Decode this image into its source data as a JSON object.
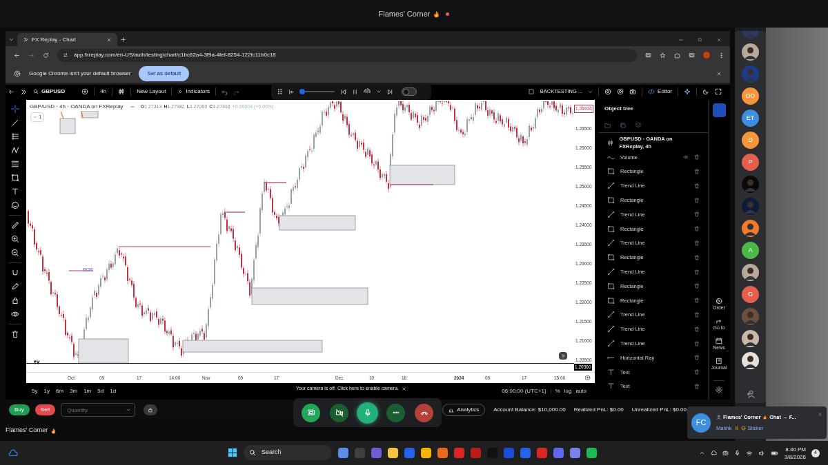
{
  "call": {
    "title": "Flames' Corner",
    "footer_label": "Flames' Corner",
    "camera_notice": "Your camera is off. Click here to enable camera.",
    "controls": [
      {
        "kind": "share",
        "selected": false
      },
      {
        "kind": "camera",
        "selected": false
      },
      {
        "kind": "mic",
        "selected": true
      },
      {
        "kind": "more",
        "selected": false
      },
      {
        "kind": "hangup",
        "selected": false
      }
    ]
  },
  "browser": {
    "tab": "FX Replay - Chart",
    "url": "app.fxreplay.com/en-US/auth/testing/chart/c1bc62a4-3f9a-4fef-8254-122fc11b0c18",
    "infobar": {
      "text": "Google Chrome isn't your default browser",
      "button": "Set as default"
    }
  },
  "toolbar": {
    "symbol": "GBPUSD",
    "interval": "4h",
    "layout": "New Layout",
    "indicators": "Indicators",
    "replay": {
      "interval": "4h",
      "level": 0.05,
      "on": false
    },
    "backtest": "BACKTESTING ...",
    "editor": "Editor"
  },
  "chart": {
    "legend": "GBP/USD · 4h · OANDA on FXReplay",
    "ohlc": [
      {
        "key": "O",
        "value": "1.27313"
      },
      {
        "key": "H",
        "value": "1.27382"
      },
      {
        "key": "L",
        "value": "1.27260"
      },
      {
        "key": "C",
        "value": "1.27316"
      }
    ],
    "change": "+0.00004 (+0.00%)",
    "layer_count": "1",
    "label": "BOS",
    "price_ticks": [
      "1.26500",
      "1.26000",
      "1.25500",
      "1.25000",
      "1.24500",
      "1.24000",
      "1.23500",
      "1.23000",
      "1.22500",
      "1.22000",
      "1.21500",
      "1.21000",
      "1.20500"
    ],
    "last_price": "1.26934",
    "low_price": "1.20360",
    "time_ticks": [
      "Oct",
      "09",
      "17",
      "14:00",
      "Nov",
      "09",
      "17",
      "Dec",
      "10",
      "18",
      "2024",
      "09",
      "17",
      "15:00"
    ],
    "ranges": [
      "5y",
      "1y",
      "6m",
      "3m",
      "1m",
      "5d",
      "1d"
    ],
    "clock": "06:00:00 (UTC+1)",
    "scale_options": [
      "%",
      "log",
      "auto"
    ]
  },
  "object_tree": {
    "title": "Object tree",
    "items": [
      {
        "kind": "series",
        "label": "GBPUSD · OANDA on FXReplay, 4h"
      },
      {
        "kind": "volume",
        "label": "Volume"
      },
      {
        "kind": "rectangle",
        "label": "Rectangle"
      },
      {
        "kind": "trend",
        "label": "Trend Line"
      },
      {
        "kind": "rectangle",
        "label": "Rectangle"
      },
      {
        "kind": "trend",
        "label": "Trend Line"
      },
      {
        "kind": "rectangle",
        "label": "Rectangle"
      },
      {
        "kind": "trend",
        "label": "Trend Line"
      },
      {
        "kind": "rectangle",
        "label": "Rectangle"
      },
      {
        "kind": "trend",
        "label": "Trend Line"
      },
      {
        "kind": "rectangle",
        "label": "Rectangle"
      },
      {
        "kind": "rectangle",
        "label": "Rectangle"
      },
      {
        "kind": "trend",
        "label": "Trend Line"
      },
      {
        "kind": "trend",
        "label": "Trend Line"
      },
      {
        "kind": "trend",
        "label": "Trend Line"
      },
      {
        "kind": "ray",
        "label": "Horizontal Ray"
      },
      {
        "kind": "text",
        "label": "Text"
      },
      {
        "kind": "text",
        "label": "Text"
      }
    ]
  },
  "side_panel": [
    "Order",
    "Go to",
    "News",
    "Journal"
  ],
  "trading": {
    "buy": "Buy",
    "sell": "Sell",
    "quantity_placeholder": "Quantity",
    "analytics": "Analytics",
    "balance": "Account Balance: $10,000.00",
    "realized": "Realized PnL: $0.00",
    "unrealized": "Unrealized PnL: $0.00"
  },
  "participants": [
    {
      "kind": "picture"
    },
    {
      "kind": "picture"
    },
    {
      "kind": "picture"
    },
    {
      "kind": "initials",
      "initials": "DO",
      "color": "#f7953b"
    },
    {
      "kind": "initials",
      "initials": "ET",
      "color": "#3d8fe0"
    },
    {
      "kind": "initials",
      "initials": "D",
      "color": "#f7953b"
    },
    {
      "kind": "initials",
      "initials": "P",
      "color": "#e3604f"
    },
    {
      "kind": "picture"
    },
    {
      "kind": "picture"
    },
    {
      "kind": "picture"
    },
    {
      "kind": "initials",
      "initials": "A",
      "color": "#4cb84c"
    },
    {
      "kind": "picture"
    },
    {
      "kind": "initials",
      "initials": "G",
      "color": "#e3604f"
    },
    {
      "kind": "picture"
    },
    {
      "kind": "picture"
    },
    {
      "kind": "picture"
    }
  ],
  "notification": {
    "initials": "FC",
    "title": "Flames' Corner",
    "title_rest": "Chat → F...",
    "sender": "Mahhk",
    "content": "Sticker"
  },
  "taskbar": {
    "search": "Search",
    "time": "8:40 PM",
    "date": "3/8/2026",
    "badge": "4"
  }
}
